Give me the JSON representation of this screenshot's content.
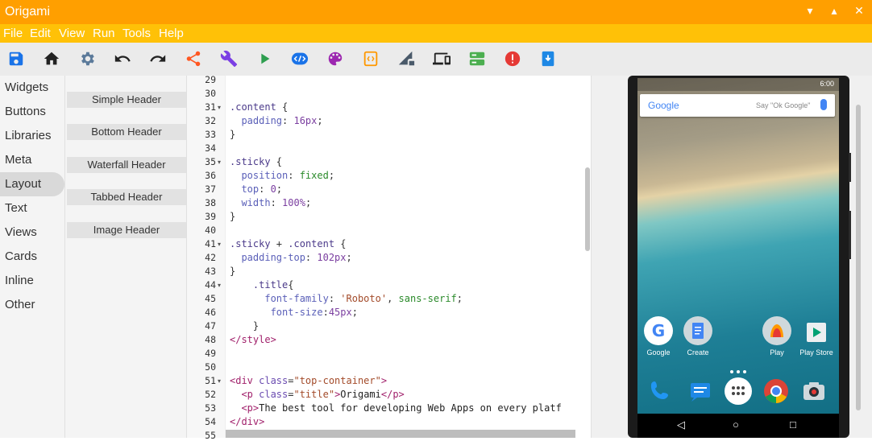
{
  "window": {
    "title": "Origami",
    "minimize": "▾",
    "maximize": "▴",
    "close": "✕"
  },
  "menu": [
    "File",
    "Edit",
    "View",
    "Run",
    "Tools",
    "Help"
  ],
  "toolbar": {
    "icons": [
      "save-icon",
      "home-icon",
      "settings-icon",
      "undo-icon",
      "redo-icon",
      "share-icon",
      "wrench-icon",
      "play-icon",
      "code-icon",
      "palette-icon",
      "frame-icon",
      "signal-lock-icon",
      "devices-icon",
      "storage-icon",
      "error-icon",
      "download-icon"
    ],
    "colors": {
      "save": "#1a73e8",
      "share": "#ff5722",
      "wrench": "#7b3fe4",
      "play": "#2e9e4f",
      "code": "#1a73e8",
      "palette": "#9c27b0",
      "frame": "#ff9800",
      "storage": "#4caf50",
      "error": "#e53935",
      "download": "#1e88e5"
    }
  },
  "sidebar": {
    "items": [
      "Widgets",
      "Buttons",
      "Libraries",
      "Meta",
      "Layout",
      "Text",
      "Views",
      "Cards",
      "Inline",
      "Other"
    ],
    "active": "Layout"
  },
  "subpanel": {
    "items": [
      "Simple Header",
      "Bottom Header",
      "Waterfall Header",
      "Tabbed Header",
      "Image Header"
    ]
  },
  "editor": {
    "lines": [
      {
        "n": "29",
        "fold": "",
        "t": []
      },
      {
        "n": "30",
        "fold": "",
        "t": []
      },
      {
        "n": "31",
        "fold": "▾",
        "t": [
          [
            "c-sel",
            ".content"
          ],
          [
            "c-punc",
            " {"
          ]
        ]
      },
      {
        "n": "32",
        "fold": "",
        "t": [
          [
            "c-prop",
            "  padding"
          ],
          [
            "c-punc",
            ": "
          ],
          [
            "c-num",
            "16px"
          ],
          [
            "c-punc",
            ";"
          ]
        ]
      },
      {
        "n": "33",
        "fold": "",
        "t": [
          [
            "c-punc",
            "}"
          ]
        ]
      },
      {
        "n": "34",
        "fold": "",
        "t": []
      },
      {
        "n": "35",
        "fold": "▾",
        "t": [
          [
            "c-sel",
            ".sticky"
          ],
          [
            "c-punc",
            " {"
          ]
        ]
      },
      {
        "n": "36",
        "fold": "",
        "t": [
          [
            "c-prop",
            "  position"
          ],
          [
            "c-punc",
            ": "
          ],
          [
            "c-val",
            "fixed"
          ],
          [
            "c-punc",
            ";"
          ]
        ]
      },
      {
        "n": "37",
        "fold": "",
        "t": [
          [
            "c-prop",
            "  top"
          ],
          [
            "c-punc",
            ": "
          ],
          [
            "c-num",
            "0"
          ],
          [
            "c-punc",
            ";"
          ]
        ]
      },
      {
        "n": "38",
        "fold": "",
        "t": [
          [
            "c-prop",
            "  width"
          ],
          [
            "c-punc",
            ": "
          ],
          [
            "c-num",
            "100%"
          ],
          [
            "c-punc",
            ";"
          ]
        ]
      },
      {
        "n": "39",
        "fold": "",
        "t": [
          [
            "c-punc",
            "}"
          ]
        ]
      },
      {
        "n": "40",
        "fold": "",
        "t": []
      },
      {
        "n": "41",
        "fold": "▾",
        "t": [
          [
            "c-sel",
            ".sticky"
          ],
          [
            "c-punc",
            " + "
          ],
          [
            "c-sel",
            ".content"
          ],
          [
            "c-punc",
            " {"
          ]
        ]
      },
      {
        "n": "42",
        "fold": "",
        "t": [
          [
            "c-prop",
            "  padding-top"
          ],
          [
            "c-punc",
            ": "
          ],
          [
            "c-num",
            "102px"
          ],
          [
            "c-punc",
            ";"
          ]
        ]
      },
      {
        "n": "43",
        "fold": "",
        "t": [
          [
            "c-punc",
            "}"
          ]
        ]
      },
      {
        "n": "44",
        "fold": "▾",
        "t": [
          [
            "c-sel",
            "    .title"
          ],
          [
            "c-punc",
            "{"
          ]
        ]
      },
      {
        "n": "45",
        "fold": "",
        "t": [
          [
            "c-prop",
            "      font-family"
          ],
          [
            "c-punc",
            ": "
          ],
          [
            "c-str",
            "'Roboto'"
          ],
          [
            "c-punc",
            ", "
          ],
          [
            "c-val",
            "sans-serif"
          ],
          [
            "c-punc",
            ";"
          ]
        ]
      },
      {
        "n": "46",
        "fold": "",
        "t": [
          [
            "c-prop",
            "       font-size"
          ],
          [
            "c-punc",
            ":"
          ],
          [
            "c-num",
            "45px"
          ],
          [
            "c-punc",
            ";"
          ]
        ]
      },
      {
        "n": "47",
        "fold": "",
        "t": [
          [
            "c-punc",
            "    }"
          ]
        ]
      },
      {
        "n": "48",
        "fold": "",
        "t": [
          [
            "c-tag",
            "</style>"
          ]
        ]
      },
      {
        "n": "49",
        "fold": "",
        "t": []
      },
      {
        "n": "50",
        "fold": "",
        "t": []
      },
      {
        "n": "51",
        "fold": "▾",
        "t": [
          [
            "c-tag",
            "<div "
          ],
          [
            "c-attr",
            "class"
          ],
          [
            "c-punc",
            "="
          ],
          [
            "c-str",
            "\"top-container\""
          ],
          [
            "c-tag",
            ">"
          ]
        ]
      },
      {
        "n": "52",
        "fold": "",
        "t": [
          [
            "c-tag",
            "  <p "
          ],
          [
            "c-attr",
            "class"
          ],
          [
            "c-punc",
            "="
          ],
          [
            "c-str",
            "\"title\""
          ],
          [
            "c-tag",
            ">"
          ],
          [
            "c-text",
            "Origami"
          ],
          [
            "c-tag",
            "</p>"
          ]
        ]
      },
      {
        "n": "53",
        "fold": "",
        "t": [
          [
            "c-tag",
            "  <p>"
          ],
          [
            "c-text",
            "The best tool for developing Web Apps on every platf"
          ]
        ]
      },
      {
        "n": "54",
        "fold": "",
        "t": [
          [
            "c-tag",
            "</div>"
          ]
        ]
      },
      {
        "n": "55",
        "fold": "",
        "t": []
      }
    ]
  },
  "phone": {
    "status_time": "6:00",
    "search": {
      "logo": "Google",
      "hint": "Say \"Ok Google\""
    },
    "apps": [
      "Google",
      "Create",
      "Play",
      "Play Store"
    ],
    "nav": {
      "back": "◁",
      "home": "○",
      "recents": "□"
    }
  }
}
